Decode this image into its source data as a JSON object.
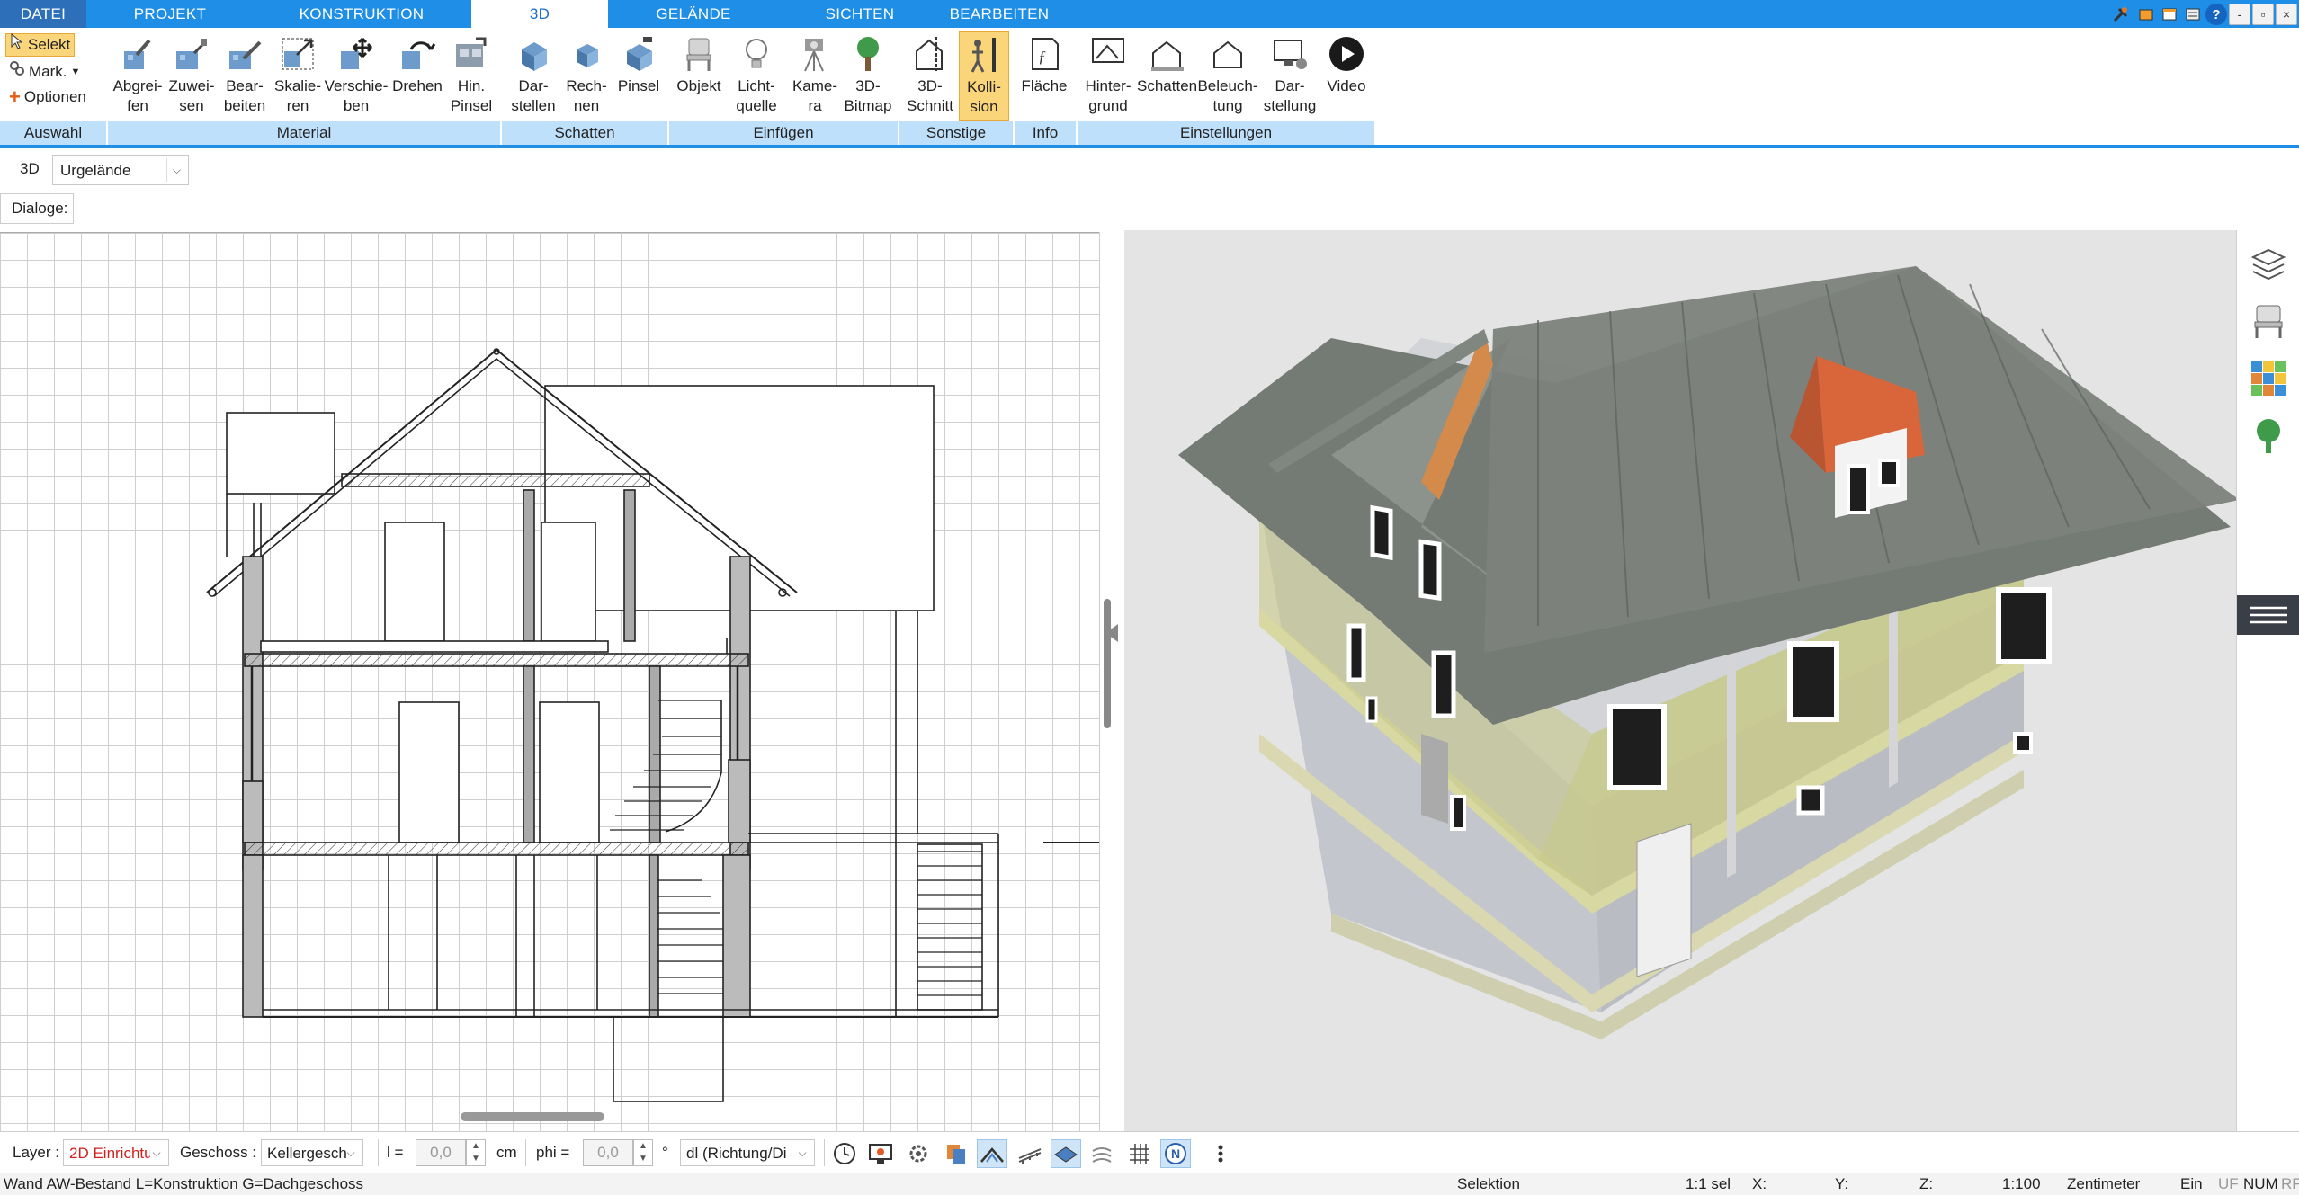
{
  "menu": {
    "tabs": [
      "DATEI",
      "PROJEKT",
      "KONSTRUKTION",
      "3D",
      "GELÄNDE",
      "SICHTEN",
      "BEARBEITEN"
    ],
    "active_tab": "3D"
  },
  "window_controls": {
    "minimize": "-",
    "restore": "▫",
    "close": "×",
    "help": "?"
  },
  "selection": {
    "selekt": "Selekt",
    "mark": "Mark.",
    "optionen": "Optionen"
  },
  "ribbon": {
    "material": {
      "abgreifen": "Abgrei-\nfen",
      "zuweisen": "Zuwei-\nsen",
      "bearbeiten": "Bear-\nbeiten",
      "skalieren": "Skalie-\nren",
      "verschieben": "Verschie-\nben",
      "drehen": "Drehen",
      "hin_pinsel": "Hin.\nPinsel"
    },
    "schatten": {
      "darstellen": "Dar-\nstellen",
      "rechnen": "Rech-\nnen",
      "pinsel": "Pinsel"
    },
    "einfuegen": {
      "objekt": "Objekt",
      "lichtquelle": "Licht-\nquelle",
      "kamera": "Kame-\nra",
      "bitmap3d": "3D-\nBitmap"
    },
    "sonstige": {
      "schnitt3d": "3D-\nSchnitt",
      "kollision": "Kolli-\nsion"
    },
    "info": {
      "flaeche": "Fläche"
    },
    "einstellungen": {
      "hintergrund": "Hinter-\ngrund",
      "schatten": "Schatten",
      "beleuchtung": "Beleuch-\ntung",
      "darstellung": "Dar-\nstellung",
      "video": "Video"
    },
    "groups": {
      "auswahl": "Auswahl",
      "material": "Material",
      "schatten": "Schatten",
      "einfuegen": "Einfügen",
      "sonstige": "Sonstige",
      "info": "Info",
      "einstellungen": "Einstellungen"
    }
  },
  "view_selector": {
    "label": "3D",
    "value": "Urgelände"
  },
  "dialoge_label": "Dialoge:",
  "bottom_toolbar": {
    "layer_label": "Layer :",
    "layer_value": "2D Einrichtu",
    "geschoss_label": "Geschoss :",
    "geschoss_value": "Kellergesch",
    "l_label": "l =",
    "l_value": "0,0",
    "l_unit": "cm",
    "phi_label": "phi =",
    "phi_value": "0,0",
    "phi_unit": "°",
    "direction_value": "dl (Richtung/Di"
  },
  "status": {
    "wall_info": "Wand AW-Bestand L=Konstruktion G=Dachgeschoss",
    "mode": "Selektion",
    "sel": "1:1 sel",
    "x": "X:",
    "y": "Y:",
    "z": "Z:",
    "scale": "1:100",
    "unit": "Zentimeter",
    "ein": "Ein",
    "uf": "UF",
    "num": "NUM",
    "rf": "RF"
  },
  "colors": {
    "accent": "#1e8ee6",
    "ribbon_group": "#bfe0fb",
    "active_button": "#fbd57a",
    "roof": "#747a74",
    "dormer_roof": "#d9663a",
    "wall_glass": "#c9ccd1",
    "floor_slab": "#c8c98a",
    "timber": "#d48a4a"
  },
  "icons": {
    "toolbar": [
      "clock-icon",
      "screen-icon",
      "settings-icon",
      "copy-icon",
      "roof-icon",
      "wall-icon",
      "layer-icon",
      "hatch-icon",
      "grid-icon",
      "north-icon",
      "more-icon"
    ],
    "sidebar": [
      "layers-icon",
      "chair-icon",
      "palette-icon",
      "tree-icon",
      "menu-icon"
    ]
  }
}
